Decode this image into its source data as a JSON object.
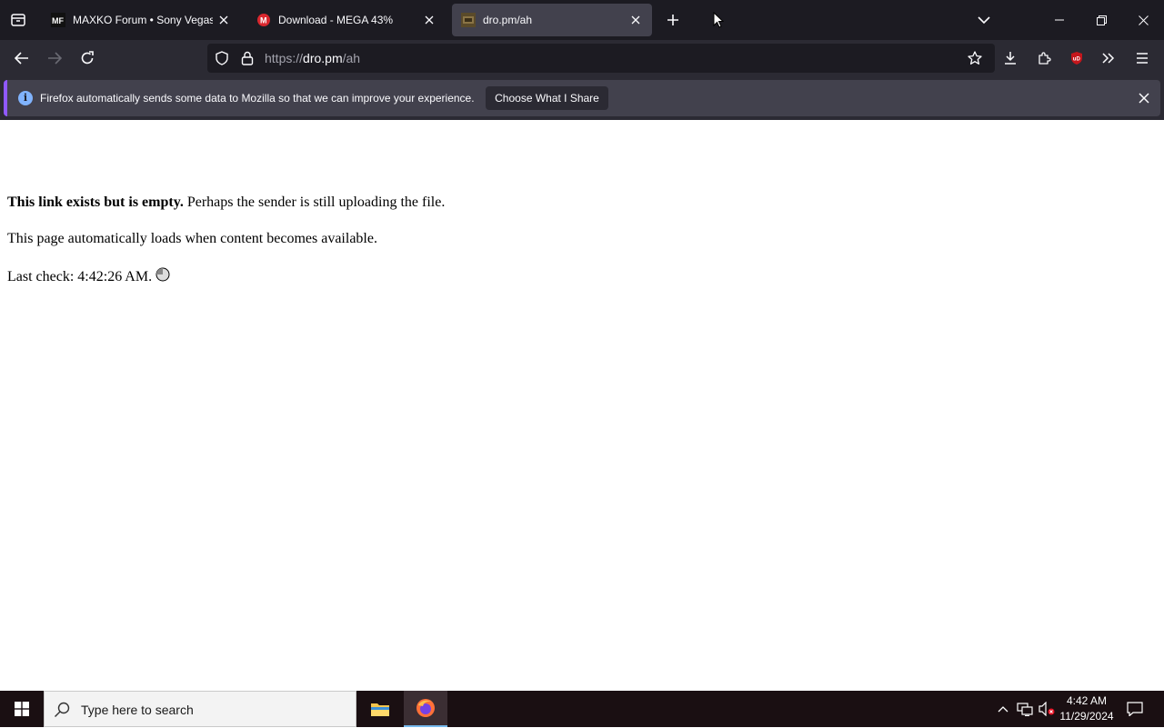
{
  "browser": {
    "tabs": [
      {
        "title": "MAXKO Forum • Sony Vegas Pro",
        "favicon": "MF",
        "selected": false
      },
      {
        "title": "Download - MEGA 43%",
        "favicon": "M",
        "selected": false
      },
      {
        "title": "dro.pm/ah",
        "favicon": "dro-icon",
        "selected": true
      }
    ],
    "url": {
      "scheme": "https://",
      "host": "dro.pm",
      "path": "/ah"
    }
  },
  "notification": {
    "message": "Firefox automatically sends some data to Mozilla so that we can improve your experience.",
    "button_label": "Choose What I Share",
    "info_glyph": "i"
  },
  "page": {
    "line1_bold": "This link exists but is empty.",
    "line1_rest": " Perhaps the sender is still uploading the file.",
    "line2": "This page automatically loads when content becomes available.",
    "line3": "Last check: 4:42:26 AM."
  },
  "taskbar": {
    "search_placeholder": "Type here to search",
    "time": "4:42 AM",
    "date": "11/29/2024"
  },
  "colors": {
    "tabstrip": "#1c1b22",
    "toolbar": "#2b2a33",
    "selected_tab": "#42414d",
    "accent": "#9059ff",
    "ublock": "#c4161c"
  }
}
